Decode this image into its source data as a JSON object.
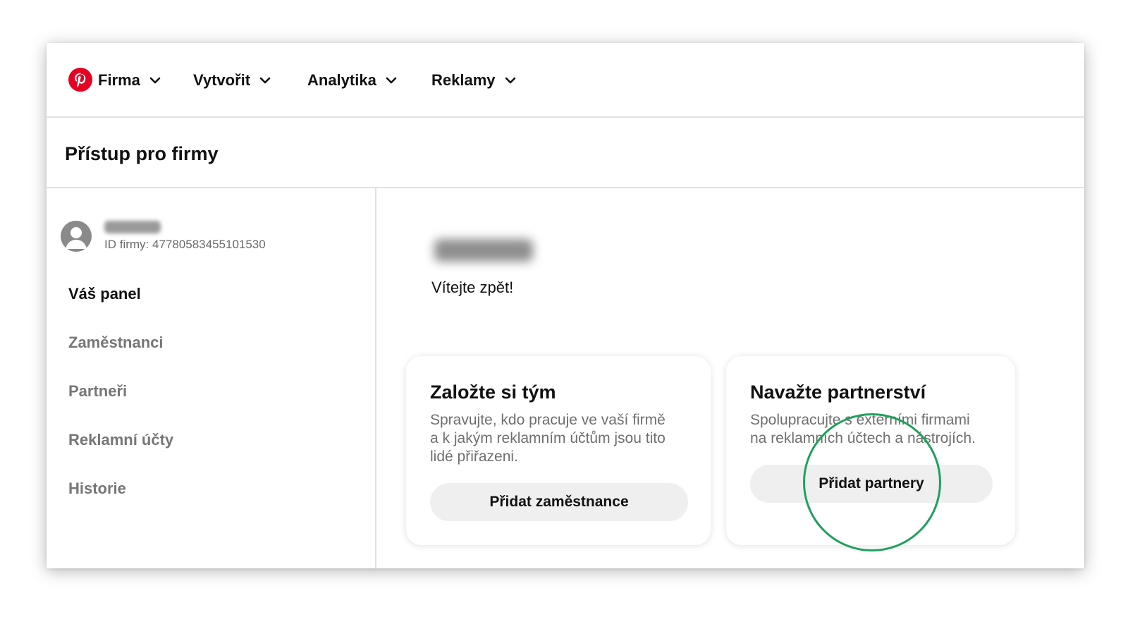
{
  "colors": {
    "brand": "#e60023",
    "highlight_circle": "#1fa05e",
    "button_bg": "#efefef",
    "muted_text": "#767676"
  },
  "nav": {
    "logo_icon": "pinterest-logo-icon",
    "items": [
      {
        "label": "Firma"
      },
      {
        "label": "Vytvořit"
      },
      {
        "label": "Analytika"
      },
      {
        "label": "Reklamy"
      }
    ]
  },
  "page": {
    "title": "Přístup pro firmy"
  },
  "sidebar": {
    "business_id": "ID firmy: 477805834551015​30",
    "items": [
      {
        "label": "Váš panel",
        "active": true
      },
      {
        "label": "Zaměstnanci"
      },
      {
        "label": "Partneři"
      },
      {
        "label": "Reklamní účty"
      },
      {
        "label": "Historie"
      }
    ]
  },
  "main": {
    "welcome": "Vítejte zpět!",
    "cards": [
      {
        "title": "Založte si tým",
        "desc": [
          "Spravujte, kdo pracuje ve vaší firmě",
          "a k jakým reklamním účtům jsou tito",
          "lidé přiřazeni."
        ],
        "button": "Přidat zaměstnance"
      },
      {
        "title": "Navažte partnerství",
        "desc": [
          "Spolupracujte s externími firmami",
          "na reklamních účtech a nástrojích."
        ],
        "button": "Přidat partnery"
      }
    ]
  }
}
